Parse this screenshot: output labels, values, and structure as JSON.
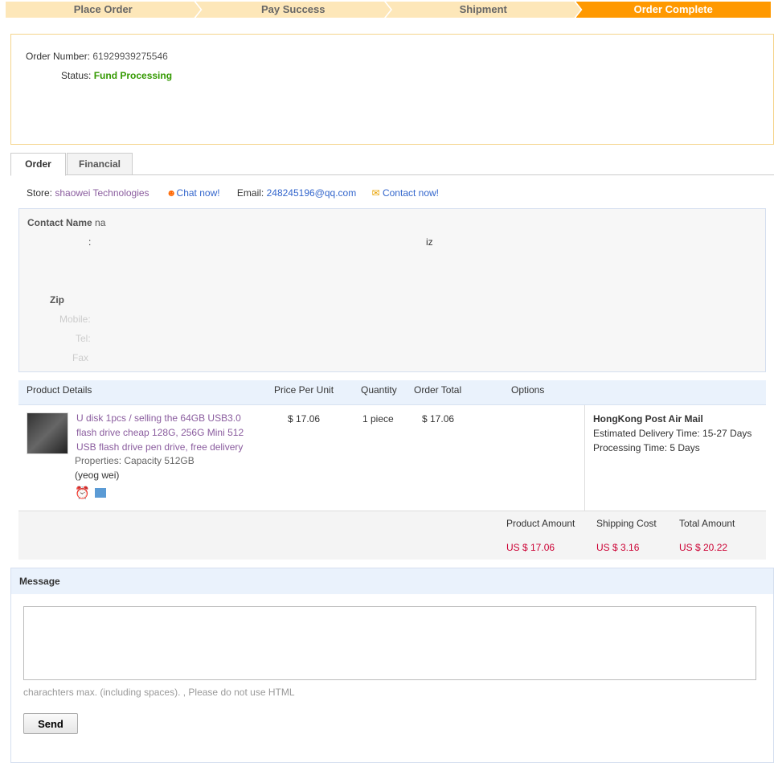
{
  "steps": [
    "Place Order",
    "Pay Success",
    "Shipment",
    "Order Complete"
  ],
  "summary": {
    "order_number_label": "Order Number:",
    "order_number": "61929939275546",
    "status_label": "Status:",
    "status": "Fund Processing"
  },
  "tabs": [
    "Order",
    "Financial"
  ],
  "store": {
    "label": "Store:",
    "name": "shaowei Technologies",
    "chat": "Chat now!",
    "email_label": "Email:",
    "email": "248245196@qq.com",
    "contact": "Contact now!"
  },
  "address": {
    "contact_label": "Contact Name",
    "contact_value": "na",
    "colon": ":",
    "addr_tail": "iz",
    "zip_label": "Zip",
    "mobile_label": "Mobile:",
    "tel_label": "Tel:",
    "fax_label": "Fax"
  },
  "table": {
    "headers": [
      "Product Details",
      "Price Per Unit",
      "Quantity",
      "Order Total",
      "Options"
    ]
  },
  "product": {
    "title": "U disk 1pcs / selling the 64GB USB3.0 flash drive cheap 128G, 256G Mini 512 USB flash drive pen drive, free delivery",
    "properties": "Properties: Capacity 512GB",
    "seller": "(yeog wei)",
    "price": "$ 17.06",
    "quantity": "1 piece",
    "total": "$ 17.06",
    "shipping_method": "HongKong Post Air Mail",
    "delivery": "Estimated Delivery Time:  15-27 Days",
    "processing": "Processing Time:  5 Days"
  },
  "totals": {
    "product_label": "Product Amount",
    "product": "US $ 17.06",
    "shipping_label": "Shipping Cost",
    "shipping": "US $ 3.16",
    "total_label": "Total Amount",
    "total": "US $ 20.22"
  },
  "message": {
    "title": "Message",
    "hint": "charachters max. (including spaces). , Please do not use HTML",
    "send": "Send"
  }
}
